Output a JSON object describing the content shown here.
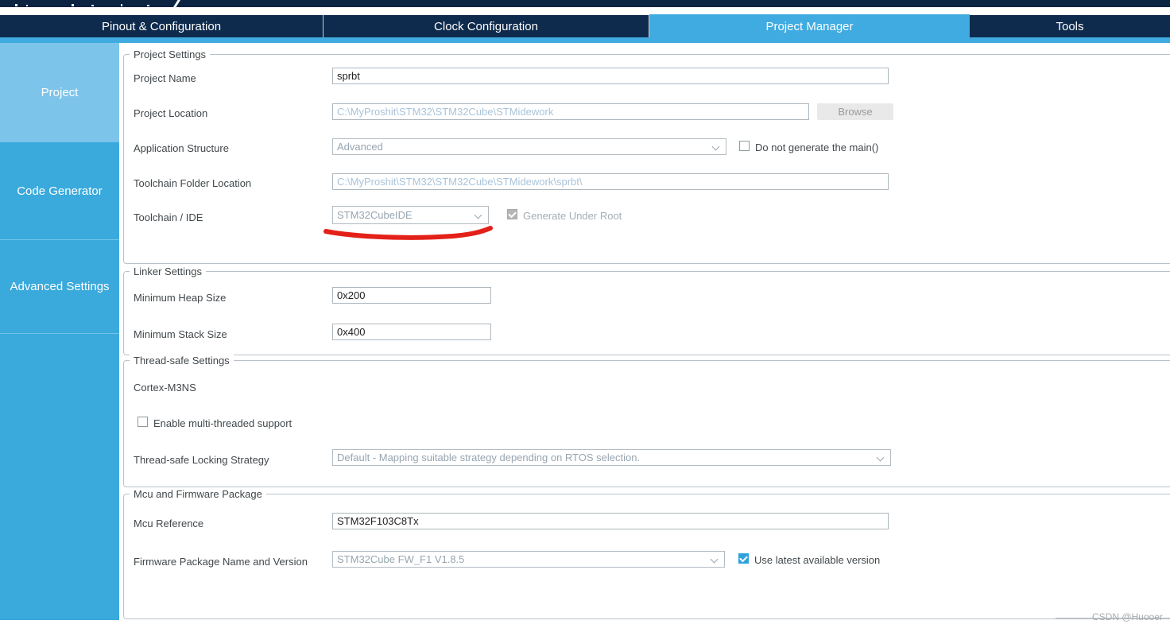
{
  "tabs": [
    {
      "label": "Pinout & Configuration",
      "active": false
    },
    {
      "label": "Clock Configuration",
      "active": false
    },
    {
      "label": "Project Manager",
      "active": true
    },
    {
      "label": "Tools",
      "active": false
    }
  ],
  "sidebar": {
    "items": [
      {
        "label": "Project",
        "active": true
      },
      {
        "label": "Code Generator",
        "active": false
      },
      {
        "label": "Advanced Settings",
        "active": false
      }
    ]
  },
  "project_settings": {
    "legend": "Project Settings",
    "project_name_label": "Project Name",
    "project_name_value": "sprbt",
    "project_location_label": "Project Location",
    "project_location_value": "C:\\MyProshit\\STM32\\STM32Cube\\STMidework",
    "browse_label": "Browse",
    "application_structure_label": "Application Structure",
    "application_structure_value": "Advanced",
    "do_not_generate_main_label": "Do not generate the main()",
    "toolchain_folder_label": "Toolchain Folder Location",
    "toolchain_folder_value": "C:\\MyProshit\\STM32\\STM32Cube\\STMidework\\sprbt\\",
    "toolchain_ide_label": "Toolchain / IDE",
    "toolchain_ide_value": "STM32CubeIDE",
    "generate_under_root_label": "Generate Under Root"
  },
  "linker_settings": {
    "legend": "Linker Settings",
    "min_heap_label": "Minimum Heap Size",
    "min_heap_value": "0x200",
    "min_stack_label": "Minimum Stack Size",
    "min_stack_value": "0x400"
  },
  "thread_safe": {
    "legend": "Thread-safe Settings",
    "core_value": "Cortex-M3NS",
    "enable_multi_label": "Enable multi-threaded support",
    "locking_label": "Thread-safe Locking Strategy",
    "locking_value": "Default - Mapping suitable strategy depending on RTOS selection."
  },
  "mcu_firmware": {
    "legend": "Mcu and Firmware Package",
    "mcu_ref_label": "Mcu Reference",
    "mcu_ref_value": "STM32F103C8Tx",
    "fw_label": "Firmware Package Name and Version",
    "fw_value": "STM32Cube FW_F1 V1.8.5",
    "use_latest_label": "Use latest available version"
  },
  "watermark": "CSDN @Huooer",
  "colors": {
    "tab_navy": "#0e2a4c",
    "active_tab_blue": "#3fabe0",
    "sidebar_blue": "#3aa9dc",
    "sidebar_active_blue": "#7dc4ea",
    "disabled_text_blue": "#a9c3d9",
    "annotation_red": "#e32119",
    "checkbox_blue": "#2ea2de"
  }
}
